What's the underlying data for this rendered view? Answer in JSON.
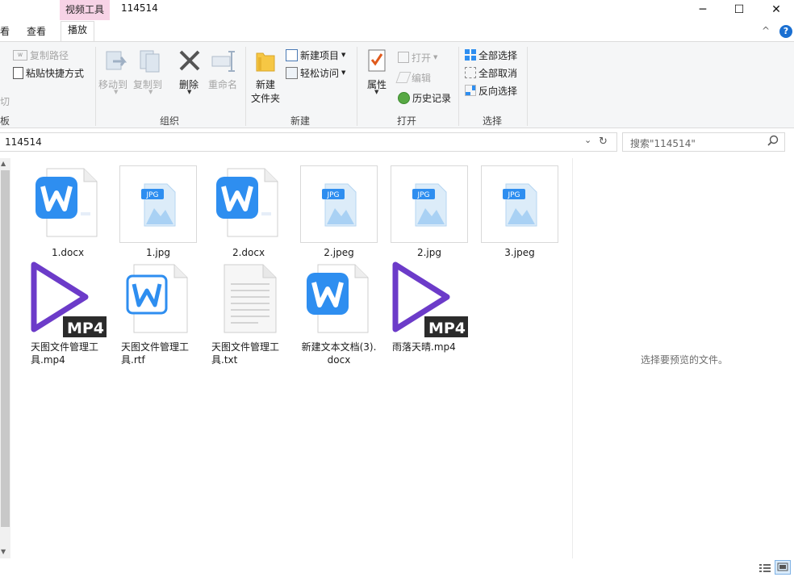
{
  "titlebar": {
    "tool_tab": "视频工具",
    "title": "114514",
    "minimize": "─",
    "maximize": "☐",
    "close": "✕"
  },
  "ribbon_tabs": {
    "partial": "看",
    "view": "查看",
    "play": "播放",
    "collapse": "^",
    "help": "?"
  },
  "ribbon": {
    "copy_path": "复制路径",
    "paste_shortcut": "粘贴快捷方式",
    "cut_partial": "切",
    "clipboard_partial": "板",
    "move_to": "移动到",
    "copy_to": "复制到",
    "delete": "删除",
    "rename": "重命名",
    "group_organize": "组织",
    "new_folder_1": "新建",
    "new_folder_2": "文件夹",
    "new_item": "新建项目",
    "easy_access": "轻松访问",
    "group_new": "新建",
    "properties": "属性",
    "open": "打开",
    "edit": "编辑",
    "history": "历史记录",
    "group_open": "打开",
    "select_all": "全部选择",
    "select_none": "全部取消",
    "invert_selection": "反向选择",
    "group_select": "选择"
  },
  "address": {
    "path": "114514",
    "search_placeholder": "搜索\"114514\""
  },
  "files": [
    {
      "name": "1.docx",
      "type": "wps"
    },
    {
      "name": "1.jpg",
      "type": "jpg"
    },
    {
      "name": "2.docx",
      "type": "wps"
    },
    {
      "name": "2.jpeg",
      "type": "jpg"
    },
    {
      "name": "2.jpg",
      "type": "jpg"
    },
    {
      "name": "3.jpeg",
      "type": "jpg"
    },
    {
      "name": "天图文件管理工具.mp4",
      "type": "mp4"
    },
    {
      "name": "天图文件管理工具.rtf",
      "type": "rtf"
    },
    {
      "name": "天图文件管理工具.txt",
      "type": "txt"
    },
    {
      "name": "新建文本文档(3).docx",
      "type": "wps"
    },
    {
      "name": "雨落天晴.mp4",
      "type": "mp4"
    }
  ],
  "badges": {
    "jpg": "JPG",
    "mp4": "MP4"
  },
  "preview": {
    "message": "选择要预览的文件。"
  },
  "colors": {
    "accent": "#2e8ef0",
    "tool_tab": "#f7d3e6",
    "mp4_purple": "#6c3bc9"
  }
}
